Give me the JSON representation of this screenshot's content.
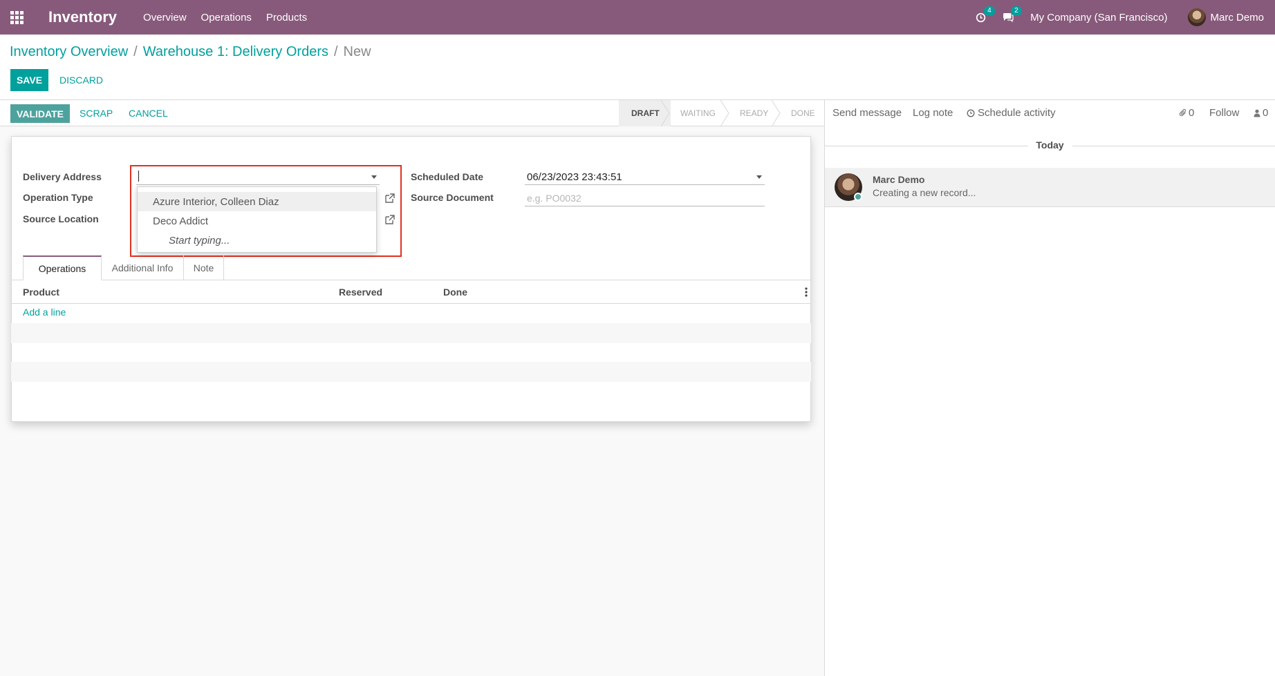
{
  "navbar": {
    "app_name": "Inventory",
    "menu": [
      "Overview",
      "Operations",
      "Products"
    ],
    "activity_count": "4",
    "message_count": "2",
    "company": "My Company (San Francisco)",
    "user": "Marc Demo"
  },
  "breadcrumb": {
    "items": [
      "Inventory Overview",
      "Warehouse 1: Delivery Orders"
    ],
    "current": "New"
  },
  "control": {
    "save_label": "SAVE",
    "discard_label": "DISCARD"
  },
  "statusbar": {
    "validate_label": "VALIDATE",
    "scrap_label": "SCRAP",
    "cancel_label": "CANCEL",
    "stages": [
      "DRAFT",
      "WAITING",
      "READY",
      "DONE"
    ],
    "active_stage": "DRAFT"
  },
  "form": {
    "delivery_address_label": "Delivery Address",
    "delivery_address_value": "",
    "operation_type_label": "Operation Type",
    "source_location_label": "Source Location",
    "scheduled_date_label": "Scheduled Date",
    "scheduled_date_value": "06/23/2023 23:43:51",
    "source_document_label": "Source Document",
    "source_document_placeholder": "e.g. PO0032"
  },
  "dropdown": {
    "options": [
      "Azure Interior, Colleen Diaz",
      "Deco Addict"
    ],
    "hint": "Start typing..."
  },
  "tabs": [
    "Operations",
    "Additional Info",
    "Note"
  ],
  "table": {
    "columns": [
      "Product",
      "Reserved",
      "Done"
    ],
    "add_line_label": "Add a line"
  },
  "chatter": {
    "send_message": "Send message",
    "log_note": "Log note",
    "schedule_activity": "Schedule activity",
    "attachments_count": "0",
    "follow": "Follow",
    "followers_count": "0",
    "date_separator": "Today",
    "message_author": "Marc Demo",
    "message_body": "Creating a new record..."
  },
  "colors": {
    "brand": "#875a7b",
    "accent": "#00a09d",
    "highlight_border": "#e0301e"
  }
}
